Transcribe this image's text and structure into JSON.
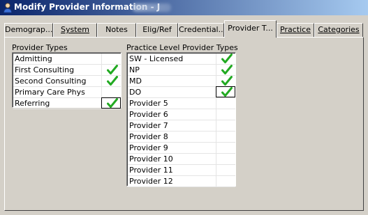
{
  "window": {
    "title": "Modify Provider Information - J",
    "colors": {
      "titlebar_start": "#0a246a",
      "titlebar_end": "#a6caf0",
      "face": "#d4d0c8",
      "check": "#22aa22"
    }
  },
  "tabs": [
    {
      "label": "Demograp...",
      "active": false
    },
    {
      "label": "System",
      "active": false
    },
    {
      "label": "Notes",
      "active": false
    },
    {
      "label": "Elig/Ref",
      "active": false
    },
    {
      "label": "Credential...",
      "active": false
    },
    {
      "label": "Provider T...",
      "active": true
    },
    {
      "label": "Practice",
      "active": false
    },
    {
      "label": "Categories",
      "active": false
    }
  ],
  "provider_types": {
    "heading": "Provider Types",
    "items": [
      {
        "label": "Admitting",
        "checked": false
      },
      {
        "label": "First Consulting",
        "checked": true
      },
      {
        "label": "Second Consulting",
        "checked": true
      },
      {
        "label": "Primary Care Phys",
        "checked": false
      },
      {
        "label": "Referring",
        "checked": true,
        "focused": true
      }
    ]
  },
  "practice_level": {
    "heading": "Practice Level Provider Types",
    "items": [
      {
        "label": "SW - Licensed",
        "checked": true
      },
      {
        "label": "NP",
        "checked": true
      },
      {
        "label": "MD",
        "checked": true
      },
      {
        "label": "DO",
        "checked": true,
        "focused": true
      },
      {
        "label": "Provider 5",
        "checked": false
      },
      {
        "label": "Provider 6",
        "checked": false
      },
      {
        "label": "Provider 7",
        "checked": false
      },
      {
        "label": "Provider 8",
        "checked": false
      },
      {
        "label": "Provider 9",
        "checked": false
      },
      {
        "label": "Provider 10",
        "checked": false
      },
      {
        "label": "Provider 11",
        "checked": false
      },
      {
        "label": "Provider 12",
        "checked": false
      }
    ]
  }
}
